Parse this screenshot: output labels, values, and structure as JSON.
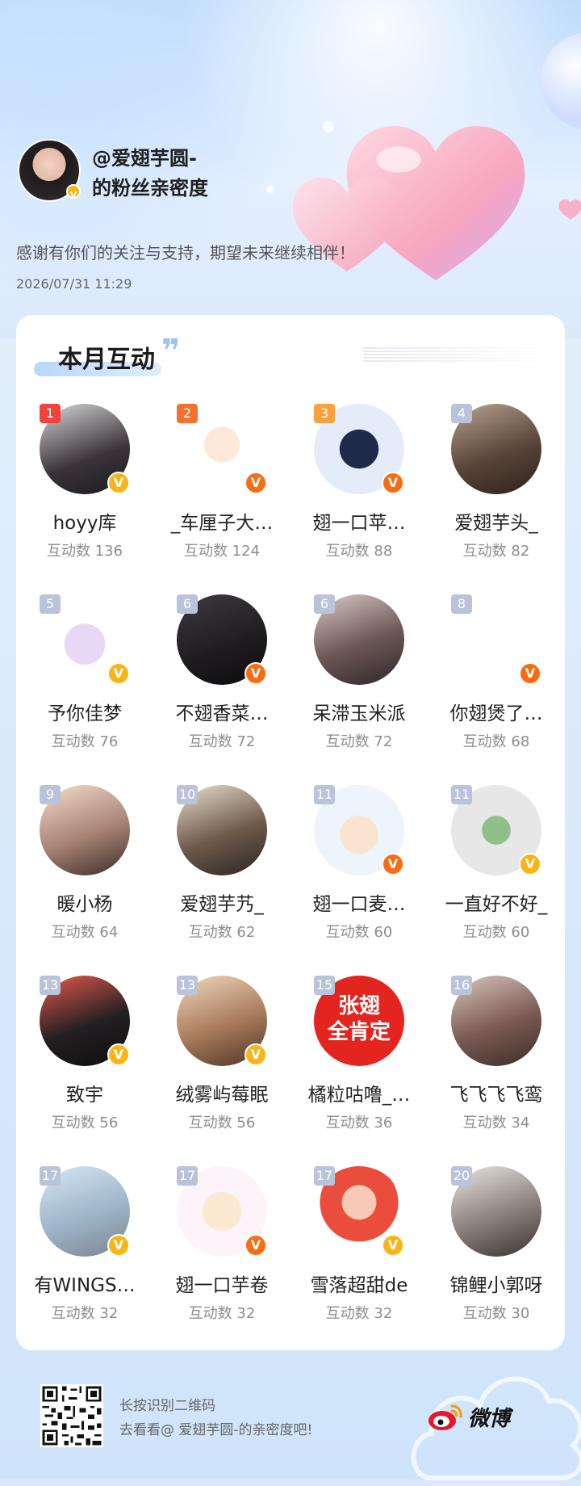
{
  "header": {
    "title_line1": "@爱翅芋圆-",
    "title_line2": "的粉丝亲密度",
    "thanks": "感谢有你们的关注与支持，期望未来继续相伴！",
    "date": "2026/07/31 11:29"
  },
  "card": {
    "title": "本月互动",
    "quote": "❞"
  },
  "fans": [
    {
      "rank": "1",
      "name": "hoyy库",
      "count": "互动数 136",
      "badge": "v-y",
      "rank_color": "#f2433b",
      "avatar": "linear-gradient(160deg,#d7d7db,#3a3337 60%,#1b1a1c)"
    },
    {
      "rank": "2",
      "name": "_车厘子大…",
      "count": "互动数 124",
      "badge": "v-o",
      "rank_color": "#f6712f",
      "avatar": "radial-gradient(circle at 50% 45%,#fde9d9 0 26%,#fff 27% 40%,#ffffff 100%)"
    },
    {
      "rank": "3",
      "name": "翅一口苹…",
      "count": "互动数 88",
      "badge": "v-o",
      "rank_color": "#f9a23b",
      "avatar": "radial-gradient(circle at 50% 50%,#1f2a4a 0 30%,#e4ecf9 31% 100%)"
    },
    {
      "rank": "4",
      "name": "爱翅芋头_",
      "count": "互动数 82",
      "badge": "",
      "rank_color": "#b9c3d9",
      "avatar": "linear-gradient(160deg,#b9a38f,#5a463a 55%,#2b211c)"
    },
    {
      "rank": "5",
      "name": "予你佳梦",
      "count": "互动数 76",
      "badge": "v-y",
      "rank_color": "#b9c3d9",
      "avatar": "radial-gradient(circle at 50% 55%,#e8d8f6 0 30%,#fff 31% 100%)"
    },
    {
      "rank": "6",
      "name": "不翅香菜…",
      "count": "互动数 72",
      "badge": "v-o",
      "rank_color": "#b9c3d9",
      "avatar": "linear-gradient(160deg,#3d3b3f,#1d1b1e 60%,#0c0b0c)"
    },
    {
      "rank": "6",
      "name": "呆滞玉米派",
      "count": "互动数 72",
      "badge": "",
      "rank_color": "#b9c3d9",
      "avatar": "linear-gradient(160deg,#d8c8c6,#6b5656 55%,#2e2626)"
    },
    {
      "rank": "8",
      "name": "你翅煲了…",
      "count": "互动数 68",
      "badge": "v-o",
      "rank_color": "#b9c3d9",
      "avatar": "radial-gradient(circle at 50% 50%,#ffffff 0 100%)"
    },
    {
      "rank": "9",
      "name": "暖小杨",
      "count": "互动数 64",
      "badge": "",
      "rank_color": "#b9c3d9",
      "avatar": "linear-gradient(160deg,#f5dccc,#a78373 55%,#3b2d29)"
    },
    {
      "rank": "10",
      "name": "爱翅芋艿_",
      "count": "互动数 62",
      "badge": "",
      "rank_color": "#b9c3d9",
      "avatar": "linear-gradient(160deg,#e9dfcf,#6e5a4a 55%,#2b2522)"
    },
    {
      "rank": "11",
      "name": "翅一口麦…",
      "count": "互动数 60",
      "badge": "v-o",
      "rank_color": "#b9c3d9",
      "avatar": "radial-gradient(circle at 50% 55%,#fbe4cf 0 28%,#eef4fc 29% 100%)"
    },
    {
      "rank": "11",
      "name": "一直好不好_",
      "count": "互动数 60",
      "badge": "v-y",
      "rank_color": "#b9c3d9",
      "avatar": "radial-gradient(circle at 50% 50%,#8fc08a 0 22%,#e7e7e7 23% 100%)"
    },
    {
      "rank": "13",
      "name": "致宇",
      "count": "互动数 56",
      "badge": "v-y",
      "rank_color": "#b9c3d9",
      "avatar": "linear-gradient(160deg,#e55a4d,#231f22 55%,#0d0c0d)"
    },
    {
      "rank": "13",
      "name": "绒雾屿莓眠",
      "count": "互动数 56",
      "badge": "v-y",
      "rank_color": "#b9c3d9",
      "avatar": "linear-gradient(160deg,#f2d8bf,#a77a5a 55%,#4d3627)"
    },
    {
      "rank": "15",
      "name": "橘粒咕噜_…",
      "count": "互动数 36",
      "badge": "",
      "rank_color": "#b9c3d9",
      "avatar": "radial-gradient(circle at 50% 50%,#e4241e 0 100%)",
      "overlay": "张翅\n全肯定"
    },
    {
      "rank": "16",
      "name": "飞飞飞飞鸾",
      "count": "互动数 34",
      "badge": "",
      "rank_color": "#b9c3d9",
      "avatar": "linear-gradient(160deg,#d9c6bd,#7b5a52 55%,#3b2c28)"
    },
    {
      "rank": "17",
      "name": "有WINGS…",
      "count": "互动数 32",
      "badge": "v-y",
      "rank_color": "#b9c3d9",
      "avatar": "linear-gradient(160deg,#d6e7f5,#9db5c8 55%,#7a8490)"
    },
    {
      "rank": "17",
      "name": "翅一口芋卷",
      "count": "互动数 32",
      "badge": "v-o",
      "rank_color": "#b9c3d9",
      "avatar": "radial-gradient(circle at 50% 50%,#fbe9d2 0 30%,#fdf4fa 31% 100%)"
    },
    {
      "rank": "17",
      "name": "雪落超甜de",
      "count": "互动数 32",
      "badge": "v-y",
      "rank_color": "#b9c3d9",
      "avatar": "radial-gradient(circle at 50% 40%,#f7c9b6 0 24%,#ea4d3b 25% 55%,#fff 56% 100%)"
    },
    {
      "rank": "20",
      "name": "锦鲤小郭呀",
      "count": "互动数 30",
      "badge": "",
      "rank_color": "#b9c3d9",
      "avatar": "linear-gradient(160deg,#e9e5e2,#8a7f7a 55%,#3a3432)"
    }
  ],
  "footer": {
    "line1": "长按识别二维码",
    "line2": "去看看@ 爱翅芋圆-的亲密度吧!",
    "brand": "微博"
  },
  "icons": {
    "verified": "V",
    "verified_colors": {
      "yellow": "#f9b417",
      "orange": "#fa6b12"
    }
  }
}
